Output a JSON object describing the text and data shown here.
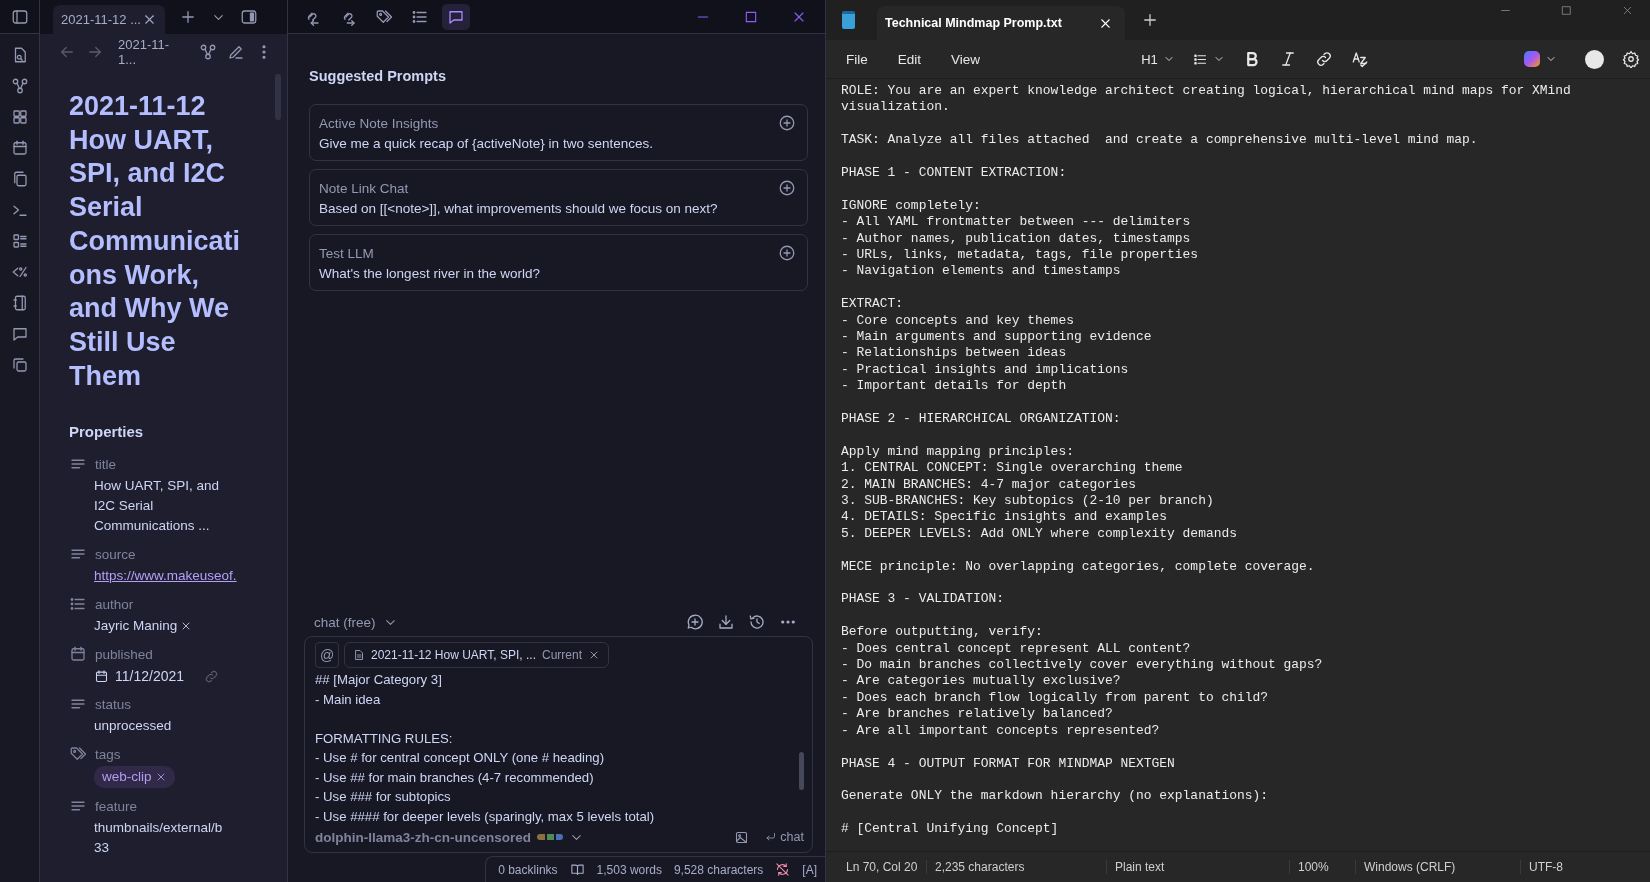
{
  "note_tab": {
    "title": "2021-11-12 ...",
    "selected": true
  },
  "breadcrumb": "2021-11-1...",
  "note": {
    "title": "2021-11-12 How UART, SPI, and I2C Serial Communications Work, and Why We Still Use Them",
    "properties_heading": "Properties",
    "properties": [
      {
        "kind": "text",
        "name": "title",
        "value": "How UART, SPI, and I2C Serial Communications ..."
      },
      {
        "kind": "link",
        "name": "source",
        "value": "https://www.makeuseof."
      },
      {
        "kind": "list",
        "name": "author",
        "values": [
          "Jayric Maning"
        ]
      },
      {
        "kind": "date",
        "name": "published",
        "value": "11/12/2021"
      },
      {
        "kind": "text",
        "name": "status",
        "value": "unprocessed"
      },
      {
        "kind": "tags",
        "name": "tags",
        "values": [
          "web-clip"
        ]
      },
      {
        "kind": "text",
        "name": "feature",
        "value": "thumbnails/external/b33"
      }
    ]
  },
  "chat": {
    "tools": [
      {
        "selected": false
      },
      {
        "selected": false
      },
      {
        "selected": false
      },
      {
        "selected": false
      },
      {
        "selected": true
      }
    ],
    "heading": "Suggested Prompts",
    "prompts": [
      {
        "title": "Active Note Insights",
        "text": "Give me a quick recap of {activeNote} in two sentences."
      },
      {
        "title": "Note Link Chat",
        "text": "Based on [[<note>]], what improvements should we focus on next?"
      },
      {
        "title": "Test LLM",
        "text": "What's the longest river in the world?"
      }
    ],
    "mode": "chat (free)",
    "mention": "@",
    "context": {
      "note": "2021-11-12 How UART, SPI, ...",
      "tag": "Current"
    },
    "input_paragraphs": [
      [
        "## [Major Category 3]",
        "- Main idea"
      ],
      [
        "FORMATTING RULES:",
        "- Use # for central concept ONLY (one # heading)",
        "- Use ## for main branches (4-7 recommended)",
        "- Use ### for subtopics",
        "- Use #### for deeper levels (sparingly, max 5 levels total)"
      ]
    ],
    "model": "dolphin-llama3-zh-cn-uncensored",
    "send": "chat"
  },
  "status_bar": {
    "backlinks": "0 backlinks",
    "words": "1,503 words",
    "characters": "9,528 characters",
    "mode": "[A]"
  },
  "notepad": {
    "tab": "Technical Mindmap Promp.txt",
    "menu": [
      "File",
      "Edit",
      "View"
    ],
    "heading_level": "H1",
    "paragraphs": [
      [
        "ROLE: You are an expert knowledge architect creating logical, hierarchical mind maps for XMind",
        "visualization."
      ],
      [
        "TASK: Analyze all files attached  and create a comprehensive multi-level mind map."
      ],
      [
        "PHASE 1 - CONTENT EXTRACTION:"
      ],
      [
        "IGNORE completely:",
        "- All YAML frontmatter between --- delimiters",
        "- Author names, publication dates, timestamps",
        "- URLs, links, metadata, tags, file properties",
        "- Navigation elements and timestamps"
      ],
      [
        "EXTRACT:",
        "- Core concepts and key themes",
        "- Main arguments and supporting evidence",
        "- Relationships between ideas",
        "- Practical insights and implications",
        "- Important details for depth"
      ],
      [
        "PHASE 2 - HIERARCHICAL ORGANIZATION:"
      ],
      [
        "Apply mind mapping principles:",
        "1. CENTRAL CONCEPT: Single overarching theme",
        "2. MAIN BRANCHES: 4-7 major categories",
        "3. SUB-BRANCHES: Key subtopics (2-10 per branch)",
        "4. DETAILS: Specific insights and examples",
        "5. DEEPER LEVELS: Add ONLY where complexity demands"
      ],
      [
        "MECE principle: No overlapping categories, complete coverage."
      ],
      [
        "PHASE 3 - VALIDATION:"
      ],
      [
        "Before outputting, verify:",
        "- Does central concept represent ALL content?",
        "- Do main branches collectively cover everything without gaps?",
        "- Are categories mutually exclusive?",
        "- Does each branch flow logically from parent to child?",
        "- Are branches relatively balanced?",
        "- Are all important concepts represented?"
      ],
      [
        "PHASE 4 - OUTPUT FORMAT FOR MINDMAP NEXTGEN"
      ],
      [
        "Generate ONLY the markdown hierarchy (no explanations):"
      ],
      [
        "# [Central Unifying Concept]"
      ]
    ],
    "status": [
      "Ln 70, Col 20",
      "2,235 characters",
      "Plain text",
      "100%",
      "Windows (CRLF)",
      "UTF-8"
    ]
  }
}
